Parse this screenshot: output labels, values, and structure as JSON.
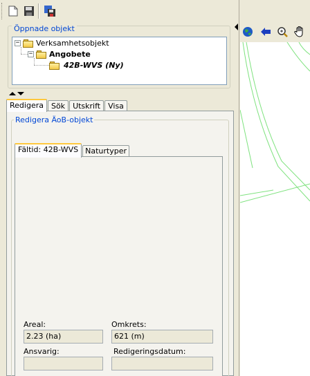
{
  "toolbar": {
    "buttons": [
      {
        "name": "new-document-icon"
      },
      {
        "name": "save-icon"
      },
      {
        "name": "save-as-icon"
      }
    ]
  },
  "opened_objects": {
    "legend": "Öppnade objekt",
    "tree": [
      {
        "label": "Verksamhetsobjekt",
        "expander": "−",
        "bold": false,
        "italic": false
      },
      {
        "label": "Angobete",
        "expander": "−",
        "bold": true,
        "italic": false
      },
      {
        "label": "42B-WVS (Ny)",
        "expander": "",
        "bold": true,
        "italic": true
      }
    ]
  },
  "main_tabs": [
    {
      "label": "Redigera",
      "active": true
    },
    {
      "label": "Sök",
      "active": false
    },
    {
      "label": "Utskrift",
      "active": false
    },
    {
      "label": "Visa",
      "active": false
    }
  ],
  "edit_group": {
    "legend": "Redigera ÄoB-objekt",
    "inner_tabs": [
      {
        "label": "Fältid: 42B-WVS",
        "active": true
      },
      {
        "label": "Naturtyper",
        "active": false
      }
    ],
    "fields": {
      "areal_label": "Areal:",
      "areal_value": "2.23 (ha)",
      "omkrets_label": "Omkrets:",
      "omkrets_value": "621 (m)",
      "ansvarig_label": "Ansvarig:",
      "ansvarig_value": "",
      "redigeringsdatum_label": "Redigeringsdatum:",
      "redigeringsdatum_value": ""
    }
  },
  "map_toolbar": {
    "buttons": [
      {
        "name": "globe-icon"
      },
      {
        "name": "back-arrow-icon"
      },
      {
        "name": "zoom-icon"
      },
      {
        "name": "pan-hand-icon"
      }
    ]
  },
  "colors": {
    "accent_blue": "#0046d5",
    "map_line": "#7ee27e",
    "tab_highlight": "#ffc83c"
  }
}
